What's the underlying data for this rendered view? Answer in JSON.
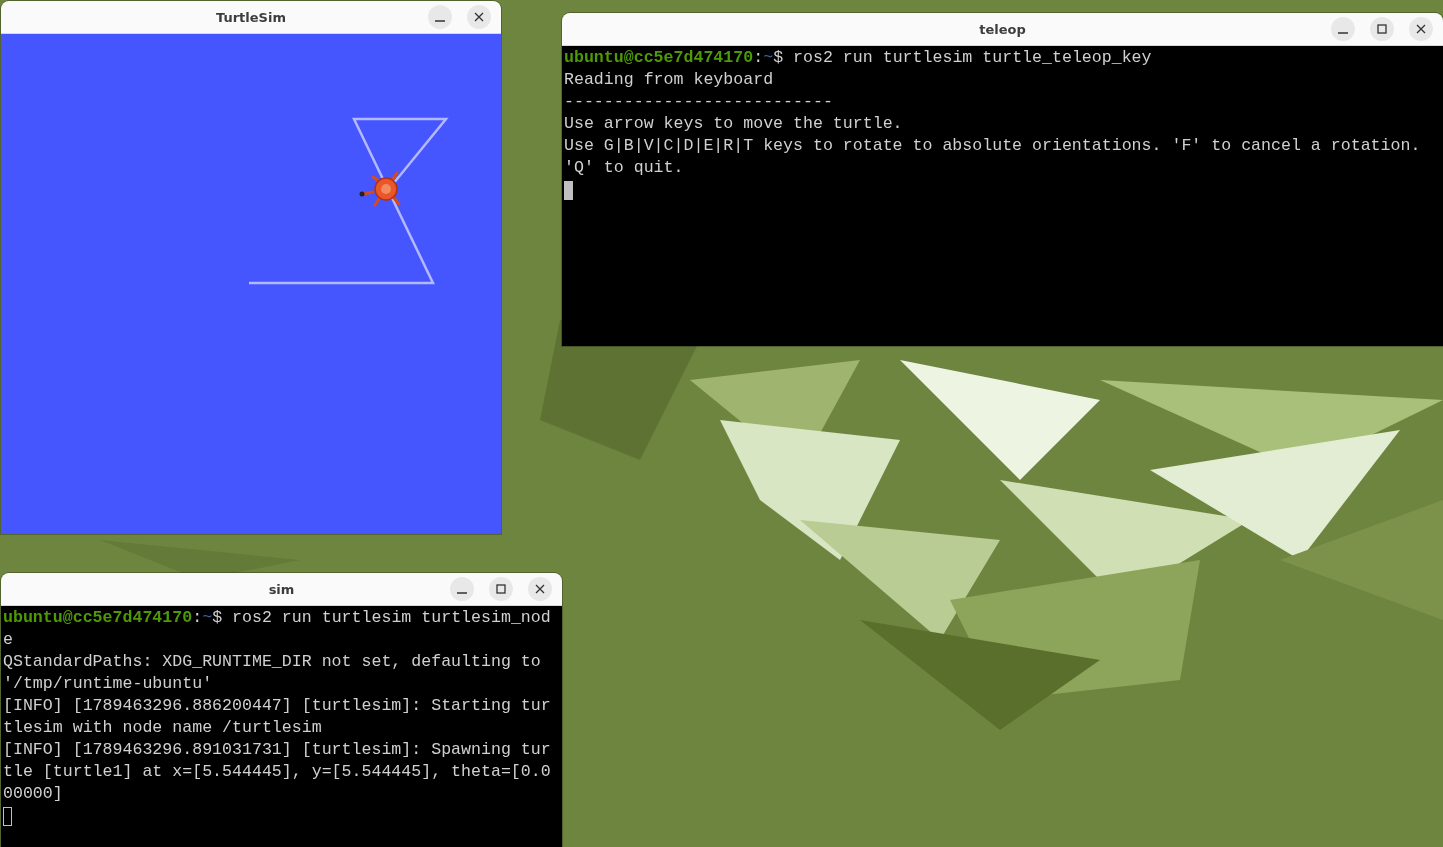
{
  "windows": [
    {
      "kind": "canvas",
      "title": "TurtleSim",
      "controls": [
        {
          "kind": "minimize"
        },
        {
          "kind": "close"
        }
      ]
    },
    {
      "kind": "terminal",
      "title": "teleop",
      "controls": [
        {
          "kind": "minimize"
        },
        {
          "kind": "maximize"
        },
        {
          "kind": "close"
        }
      ],
      "cursor": {
        "focused": true
      },
      "lines": [
        [
          {
            "kind": "user",
            "text": "ubuntu@cc5e7d474170"
          },
          {
            "kind": "plain",
            "text": ":"
          },
          {
            "kind": "path",
            "text": "~"
          },
          {
            "kind": "plain",
            "text": "$ ros2 run turtlesim turtle_teleop_key"
          }
        ],
        [
          {
            "kind": "plain",
            "text": "Reading from keyboard"
          }
        ],
        [
          {
            "kind": "plain",
            "text": "---------------------------"
          }
        ],
        [
          {
            "kind": "plain",
            "text": "Use arrow keys to move the turtle."
          }
        ],
        [
          {
            "kind": "plain",
            "text": "Use G|B|V|C|D|E|R|T keys to rotate to absolute orientations. 'F' to cancel a rotation."
          }
        ],
        [
          {
            "kind": "plain",
            "text": "'Q' to quit."
          }
        ]
      ]
    },
    {
      "kind": "terminal",
      "title": "sim",
      "controls": [
        {
          "kind": "minimize"
        },
        {
          "kind": "maximize"
        },
        {
          "kind": "close"
        }
      ],
      "cursor": {
        "focused": false
      },
      "lines": [
        [
          {
            "kind": "user",
            "text": "ubuntu@cc5e7d474170"
          },
          {
            "kind": "plain",
            "text": ":"
          },
          {
            "kind": "path",
            "text": "~"
          },
          {
            "kind": "plain",
            "text": "$ ros2 run turtlesim turtlesim_nod"
          }
        ],
        [
          {
            "kind": "plain",
            "text": "e"
          }
        ],
        [
          {
            "kind": "plain",
            "text": "QStandardPaths: XDG_RUNTIME_DIR not set, defaulting to"
          }
        ],
        [
          {
            "kind": "plain",
            "text": "'/tmp/runtime-ubuntu'"
          }
        ],
        [
          {
            "kind": "plain",
            "text": "[INFO] [1789463296.886200447] [turtlesim]: Starting tur"
          }
        ],
        [
          {
            "kind": "plain",
            "text": "tlesim with node name /turtlesim"
          }
        ],
        [
          {
            "kind": "plain",
            "text": "[INFO] [1789463296.891031731] [turtlesim]: Spawning tur"
          }
        ],
        [
          {
            "kind": "plain",
            "text": "tle [turtle1] at x=[5.544445], y=[5.544445], theta=[0.0"
          }
        ],
        [
          {
            "kind": "plain",
            "text": "00000]"
          }
        ]
      ]
    }
  ]
}
